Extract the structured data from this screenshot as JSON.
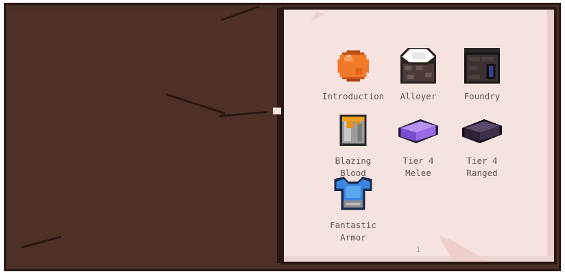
{
  "entries": [
    {
      "label": "Introduction",
      "icon": "orange-orb-icon"
    },
    {
      "label": "Alloyer",
      "icon": "alloyer-block-icon"
    },
    {
      "label": "Foundry",
      "icon": "foundry-block-icon"
    },
    {
      "label": "Blazing\nBlood",
      "icon": "blazing-blood-bucket-icon"
    },
    {
      "label": "Tier 4\nMelee",
      "icon": "purple-ingot-icon"
    },
    {
      "label": "Tier 4\nRanged",
      "icon": "dark-ingot-icon"
    },
    {
      "label": "Fantastic\nArmor",
      "icon": "blue-chestplate-icon"
    }
  ],
  "page_number": "1",
  "colors": {
    "cover": "#4d3129",
    "page": "#f6e3e0",
    "text": "#5a5252"
  }
}
